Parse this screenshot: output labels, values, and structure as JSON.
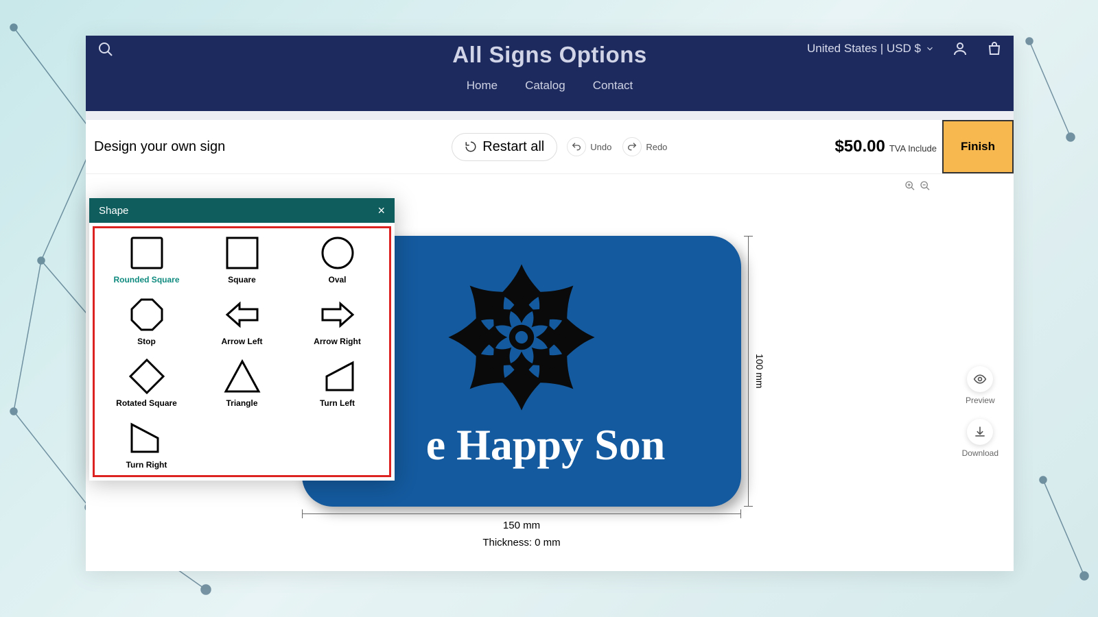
{
  "header": {
    "brand": "All Signs Options",
    "region": "United States | USD $",
    "nav": [
      "Home",
      "Catalog",
      "Contact"
    ]
  },
  "toolbar": {
    "title": "Design your own sign",
    "restart": "Restart all",
    "undo": "Undo",
    "redo": "Redo",
    "price": "$50.00",
    "tva": "TVA Include",
    "finish": "Finish"
  },
  "sign": {
    "text": "e Happy Son",
    "width_label": "150 mm",
    "height_label": "100 mm",
    "thickness": "Thickness: 0 mm",
    "bg_color": "#145a9e"
  },
  "side": {
    "preview": "Preview",
    "download": "Download"
  },
  "shape_panel": {
    "title": "Shape",
    "shapes": [
      {
        "label": "Rounded Square",
        "active": true
      },
      {
        "label": "Square"
      },
      {
        "label": "Oval"
      },
      {
        "label": "Stop"
      },
      {
        "label": "Arrow Left"
      },
      {
        "label": "Arrow Right"
      },
      {
        "label": "Rotated Square"
      },
      {
        "label": "Triangle"
      },
      {
        "label": "Turn Left"
      },
      {
        "label": "Turn Right"
      }
    ]
  }
}
